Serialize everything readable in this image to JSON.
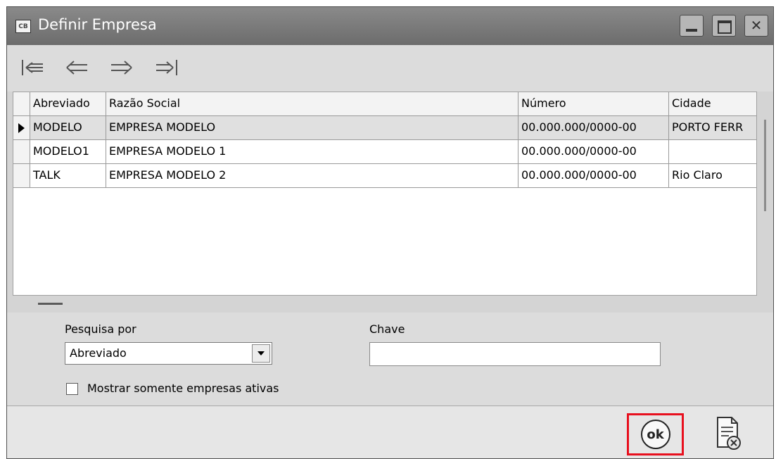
{
  "window": {
    "title": "Definir Empresa",
    "icon_label": "CB"
  },
  "toolbar": {
    "buttons": [
      "first-record-icon",
      "previous-record-icon",
      "next-record-icon",
      "last-record-icon"
    ]
  },
  "grid": {
    "columns": [
      "Abreviado",
      "Razão Social",
      "Número",
      "Cidade"
    ],
    "rows": [
      {
        "abreviado": "MODELO",
        "razao_social": "EMPRESA MODELO",
        "numero": "00.000.000/0000-00",
        "cidade": "PORTO FERR"
      },
      {
        "abreviado": "MODELO1",
        "razao_social": "EMPRESA MODELO 1",
        "numero": "00.000.000/0000-00",
        "cidade": ""
      },
      {
        "abreviado": "TALK",
        "razao_social": "EMPRESA MODELO 2",
        "numero": "00.000.000/0000-00",
        "cidade": "Rio Claro"
      }
    ],
    "selected_row": 0
  },
  "search": {
    "field_label": "Pesquisa por",
    "field_value": "Abreviado",
    "key_label": "Chave",
    "key_value": "",
    "active_only_label": "Mostrar somente empresas ativas",
    "active_only_checked": false
  },
  "actions": {
    "ok_label": "ok",
    "highlight_color": "#e8101e"
  }
}
